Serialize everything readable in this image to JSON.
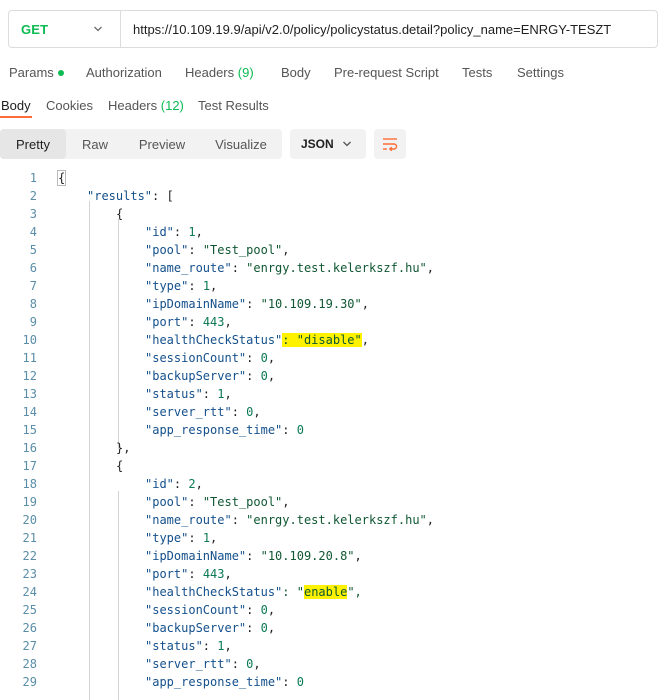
{
  "request": {
    "method": "GET",
    "url": "https://10.109.19.9/api/v2.0/policy/policystatus.detail?policy_name=ENRGY-TESZT"
  },
  "request_tabs": [
    {
      "label": "Params",
      "count": ""
    },
    {
      "label": "Authorization",
      "count": ""
    },
    {
      "label": "Headers",
      "count": "(9)"
    },
    {
      "label": "Body",
      "count": ""
    },
    {
      "label": "Pre-request Script",
      "count": ""
    },
    {
      "label": "Tests",
      "count": ""
    },
    {
      "label": "Settings",
      "count": ""
    }
  ],
  "response_tabs": [
    {
      "label": "Body",
      "count": ""
    },
    {
      "label": "Cookies",
      "count": ""
    },
    {
      "label": "Headers",
      "count": "(12)"
    },
    {
      "label": "Test Results",
      "count": ""
    }
  ],
  "view_modes": [
    "Pretty",
    "Raw",
    "Preview",
    "Visualize"
  ],
  "format": "JSON",
  "icons": {
    "method_caret": "chevron-down-icon",
    "format_caret": "chevron-down-icon",
    "wrap": "wrap-lines-icon",
    "params_indicator": "dot-icon"
  },
  "colors": {
    "method": "#0cbb52",
    "accent": "#ff6c37",
    "highlight": "#fff200",
    "key": "#14508c",
    "string": "#0f5732",
    "number": "#0b7a54"
  },
  "code_lines": [
    {
      "n": "1",
      "indent": 0,
      "tokens": [
        {
          "t": "{",
          "c": "pun box"
        }
      ]
    },
    {
      "n": "2",
      "indent": 1,
      "tokens": [
        {
          "t": "\"results\"",
          "c": "key"
        },
        {
          "t": ": [",
          "c": "pun"
        }
      ]
    },
    {
      "n": "3",
      "indent": 2,
      "tokens": [
        {
          "t": "{",
          "c": "pun"
        }
      ]
    },
    {
      "n": "4",
      "indent": 3,
      "tokens": [
        {
          "t": "\"id\"",
          "c": "key"
        },
        {
          "t": ": ",
          "c": "pun"
        },
        {
          "t": "1",
          "c": "num"
        },
        {
          "t": ",",
          "c": "pun"
        }
      ]
    },
    {
      "n": "5",
      "indent": 3,
      "tokens": [
        {
          "t": "\"pool\"",
          "c": "key"
        },
        {
          "t": ": ",
          "c": "pun"
        },
        {
          "t": "\"Test_pool\"",
          "c": "str"
        },
        {
          "t": ",",
          "c": "pun"
        }
      ]
    },
    {
      "n": "6",
      "indent": 3,
      "tokens": [
        {
          "t": "\"name_route\"",
          "c": "key"
        },
        {
          "t": ": ",
          "c": "pun"
        },
        {
          "t": "\"enrgy.test.kelerkszf.hu\"",
          "c": "str"
        },
        {
          "t": ",",
          "c": "pun"
        }
      ]
    },
    {
      "n": "7",
      "indent": 3,
      "tokens": [
        {
          "t": "\"type\"",
          "c": "key"
        },
        {
          "t": ": ",
          "c": "pun"
        },
        {
          "t": "1",
          "c": "num"
        },
        {
          "t": ",",
          "c": "pun"
        }
      ]
    },
    {
      "n": "8",
      "indent": 3,
      "tokens": [
        {
          "t": "\"ipDomainName\"",
          "c": "key"
        },
        {
          "t": ": ",
          "c": "pun"
        },
        {
          "t": "\"10.109.19.30\"",
          "c": "str"
        },
        {
          "t": ",",
          "c": "pun"
        }
      ]
    },
    {
      "n": "9",
      "indent": 3,
      "tokens": [
        {
          "t": "\"port\"",
          "c": "key"
        },
        {
          "t": ": ",
          "c": "pun"
        },
        {
          "t": "443",
          "c": "num"
        },
        {
          "t": ",",
          "c": "pun"
        }
      ]
    },
    {
      "n": "10",
      "indent": 3,
      "tokens": [
        {
          "t": "\"healthCheckStatus\"",
          "c": "key"
        },
        {
          "t": ": \"disable\"",
          "c": "str hl"
        },
        {
          "t": ",",
          "c": "pun"
        }
      ]
    },
    {
      "n": "11",
      "indent": 3,
      "tokens": [
        {
          "t": "\"sessionCount\"",
          "c": "key"
        },
        {
          "t": ": ",
          "c": "pun"
        },
        {
          "t": "0",
          "c": "num"
        },
        {
          "t": ",",
          "c": "pun"
        }
      ]
    },
    {
      "n": "12",
      "indent": 3,
      "tokens": [
        {
          "t": "\"backupServer\"",
          "c": "key"
        },
        {
          "t": ": ",
          "c": "pun"
        },
        {
          "t": "0",
          "c": "num"
        },
        {
          "t": ",",
          "c": "pun"
        }
      ]
    },
    {
      "n": "13",
      "indent": 3,
      "tokens": [
        {
          "t": "\"status\"",
          "c": "key"
        },
        {
          "t": ": ",
          "c": "pun"
        },
        {
          "t": "1",
          "c": "num"
        },
        {
          "t": ",",
          "c": "pun"
        }
      ]
    },
    {
      "n": "14",
      "indent": 3,
      "tokens": [
        {
          "t": "\"server_rtt\"",
          "c": "key"
        },
        {
          "t": ": ",
          "c": "pun"
        },
        {
          "t": "0",
          "c": "num"
        },
        {
          "t": ",",
          "c": "pun"
        }
      ]
    },
    {
      "n": "15",
      "indent": 3,
      "tokens": [
        {
          "t": "\"app_response_time\"",
          "c": "key"
        },
        {
          "t": ": ",
          "c": "pun"
        },
        {
          "t": "0",
          "c": "num"
        }
      ]
    },
    {
      "n": "16",
      "indent": 2,
      "tokens": [
        {
          "t": "},",
          "c": "pun"
        }
      ]
    },
    {
      "n": "17",
      "indent": 2,
      "tokens": [
        {
          "t": "{",
          "c": "pun"
        }
      ]
    },
    {
      "n": "18",
      "indent": 3,
      "tokens": [
        {
          "t": "\"id\"",
          "c": "key"
        },
        {
          "t": ": ",
          "c": "pun"
        },
        {
          "t": "2",
          "c": "num"
        },
        {
          "t": ",",
          "c": "pun"
        }
      ]
    },
    {
      "n": "19",
      "indent": 3,
      "tokens": [
        {
          "t": "\"pool\"",
          "c": "key"
        },
        {
          "t": ": ",
          "c": "pun"
        },
        {
          "t": "\"Test_pool\"",
          "c": "str"
        },
        {
          "t": ",",
          "c": "pun"
        }
      ]
    },
    {
      "n": "20",
      "indent": 3,
      "tokens": [
        {
          "t": "\"name_route\"",
          "c": "key"
        },
        {
          "t": ": ",
          "c": "pun"
        },
        {
          "t": "\"enrgy.test.kelerkszf.hu\"",
          "c": "str"
        },
        {
          "t": ",",
          "c": "pun"
        }
      ]
    },
    {
      "n": "21",
      "indent": 3,
      "tokens": [
        {
          "t": "\"type\"",
          "c": "key"
        },
        {
          "t": ": ",
          "c": "pun"
        },
        {
          "t": "1",
          "c": "num"
        },
        {
          "t": ",",
          "c": "pun"
        }
      ]
    },
    {
      "n": "22",
      "indent": 3,
      "tokens": [
        {
          "t": "\"ipDomainName\"",
          "c": "key"
        },
        {
          "t": ": ",
          "c": "pun"
        },
        {
          "t": "\"10.109.20.8\"",
          "c": "str"
        },
        {
          "t": ",",
          "c": "pun"
        }
      ]
    },
    {
      "n": "23",
      "indent": 3,
      "tokens": [
        {
          "t": "\"port\"",
          "c": "key"
        },
        {
          "t": ": ",
          "c": "pun"
        },
        {
          "t": "443",
          "c": "num"
        },
        {
          "t": ",",
          "c": "pun"
        }
      ]
    },
    {
      "n": "24",
      "indent": 3,
      "tokens": [
        {
          "t": "\"healthCheckStatus\"",
          "c": "key"
        },
        {
          "t": ": \"",
          "c": "str"
        },
        {
          "t": "enable",
          "c": "str hl"
        },
        {
          "t": "\",",
          "c": "str"
        }
      ]
    },
    {
      "n": "25",
      "indent": 3,
      "tokens": [
        {
          "t": "\"sessionCount\"",
          "c": "key"
        },
        {
          "t": ": ",
          "c": "pun"
        },
        {
          "t": "0",
          "c": "num"
        },
        {
          "t": ",",
          "c": "pun"
        }
      ]
    },
    {
      "n": "26",
      "indent": 3,
      "tokens": [
        {
          "t": "\"backupServer\"",
          "c": "key"
        },
        {
          "t": ": ",
          "c": "pun"
        },
        {
          "t": "0",
          "c": "num"
        },
        {
          "t": ",",
          "c": "pun"
        }
      ]
    },
    {
      "n": "27",
      "indent": 3,
      "tokens": [
        {
          "t": "\"status\"",
          "c": "key"
        },
        {
          "t": ": ",
          "c": "pun"
        },
        {
          "t": "1",
          "c": "num"
        },
        {
          "t": ",",
          "c": "pun"
        }
      ]
    },
    {
      "n": "28",
      "indent": 3,
      "tokens": [
        {
          "t": "\"server_rtt\"",
          "c": "key"
        },
        {
          "t": ": ",
          "c": "pun"
        },
        {
          "t": "0",
          "c": "num"
        },
        {
          "t": ",",
          "c": "pun"
        }
      ]
    },
    {
      "n": "29",
      "indent": 3,
      "tokens": [
        {
          "t": "\"app_response_time\"",
          "c": "key"
        },
        {
          "t": ": ",
          "c": "pun"
        },
        {
          "t": "0",
          "c": "num"
        }
      ]
    }
  ]
}
